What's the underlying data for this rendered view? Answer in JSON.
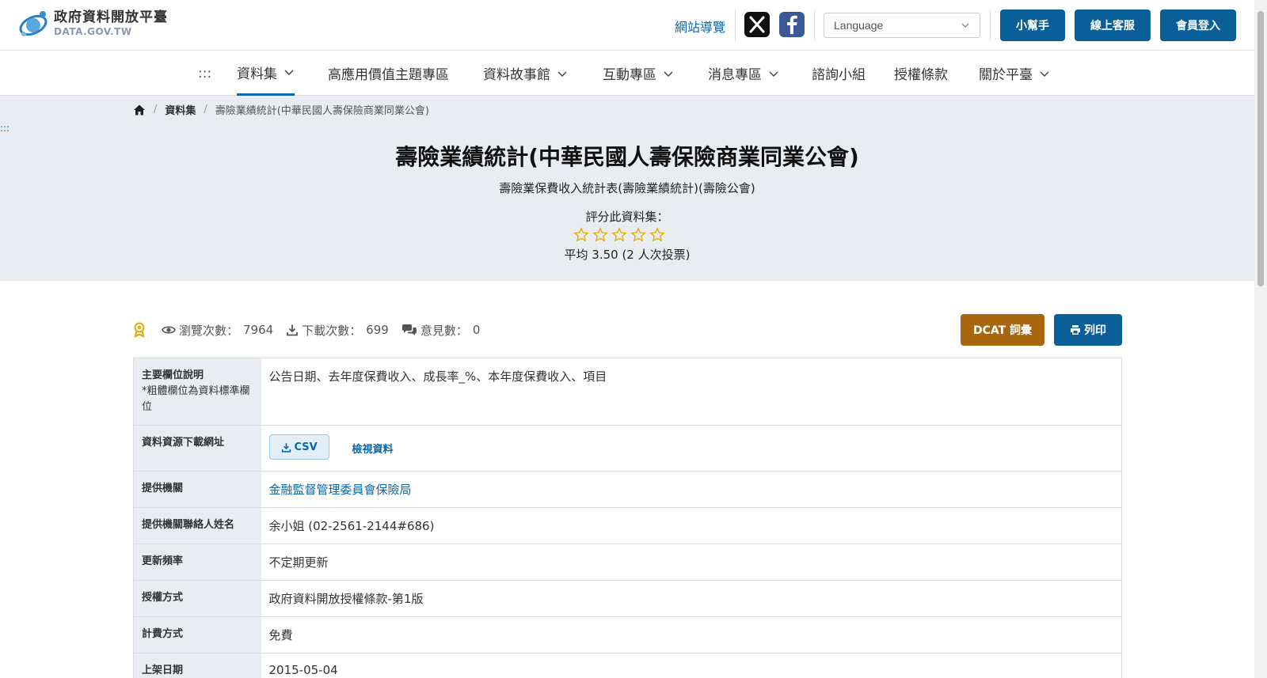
{
  "header": {
    "logo_title": "政府資料開放平臺",
    "logo_sub": "DATA.GOV.TW",
    "sitemap": "網站導覽",
    "language_placeholder": "Language",
    "helper_btn": "小幫手",
    "support_btn": "線上客服",
    "login_btn": "會員登入",
    "colors": {
      "primary": "#0b5f99",
      "link": "#0b66a7",
      "dcat": "#a8660f"
    }
  },
  "nav": {
    "menu_toggle": ":::",
    "items": [
      {
        "label": "資料集",
        "dropdown": true,
        "active": true
      },
      {
        "label": "高應用價值主題專區",
        "dropdown": false
      },
      {
        "label": "資料故事館",
        "dropdown": true
      },
      {
        "label": "互動專區",
        "dropdown": true
      },
      {
        "label": "消息專區",
        "dropdown": true
      },
      {
        "label": "諮詢小組",
        "dropdown": false
      },
      {
        "label": "授權條款",
        "dropdown": false
      },
      {
        "label": "關於平臺",
        "dropdown": true
      }
    ]
  },
  "breadcrumb": {
    "home_icon": "home-icon",
    "level1": "資料集",
    "current": "壽險業績統計(中華民國人壽保險商業同業公會)"
  },
  "side_dots": ":::",
  "dataset": {
    "title": "壽險業績統計(中華民國人壽保險商業同業公會)",
    "subtitle": "壽險業保費收入統計表(壽險業績統計)(壽險公會)",
    "rate_label": "評分此資料集：",
    "rating_stars": 5,
    "rating_average_text": "平均 3.50 (2 人次投票)"
  },
  "stats": {
    "views_label": "瀏覽次數：",
    "views": "7964",
    "downloads_label": "下載次數：",
    "downloads": "699",
    "comments_label": "意見數：",
    "comments": "0"
  },
  "actions": {
    "dcat": "DCAT 詞彙",
    "print": "列印"
  },
  "info": {
    "fields_key": "主要欄位說明",
    "fields_note": "*粗體欄位為資料標準欄位",
    "fields_value": "公告日期、去年度保費收入、成長率_%、本年度保費收入、項目",
    "resource_key": "資料資源下載網址",
    "csv_label": "CSV",
    "view_label": "檢視資料",
    "org_key": "提供機關",
    "org_value": "金融監督管理委員會保險局",
    "contact_key": "提供機關聯絡人姓名",
    "contact_value": "余小姐 (02-2561-2144#686)",
    "freq_key": "更新頻率",
    "freq_value": "不定期更新",
    "license_key": "授權方式",
    "license_value": "政府資料開放授權條款-第1版",
    "fee_key": "計費方式",
    "fee_value": "免費",
    "date_key": "上架日期",
    "date_value": "2015-05-04"
  }
}
